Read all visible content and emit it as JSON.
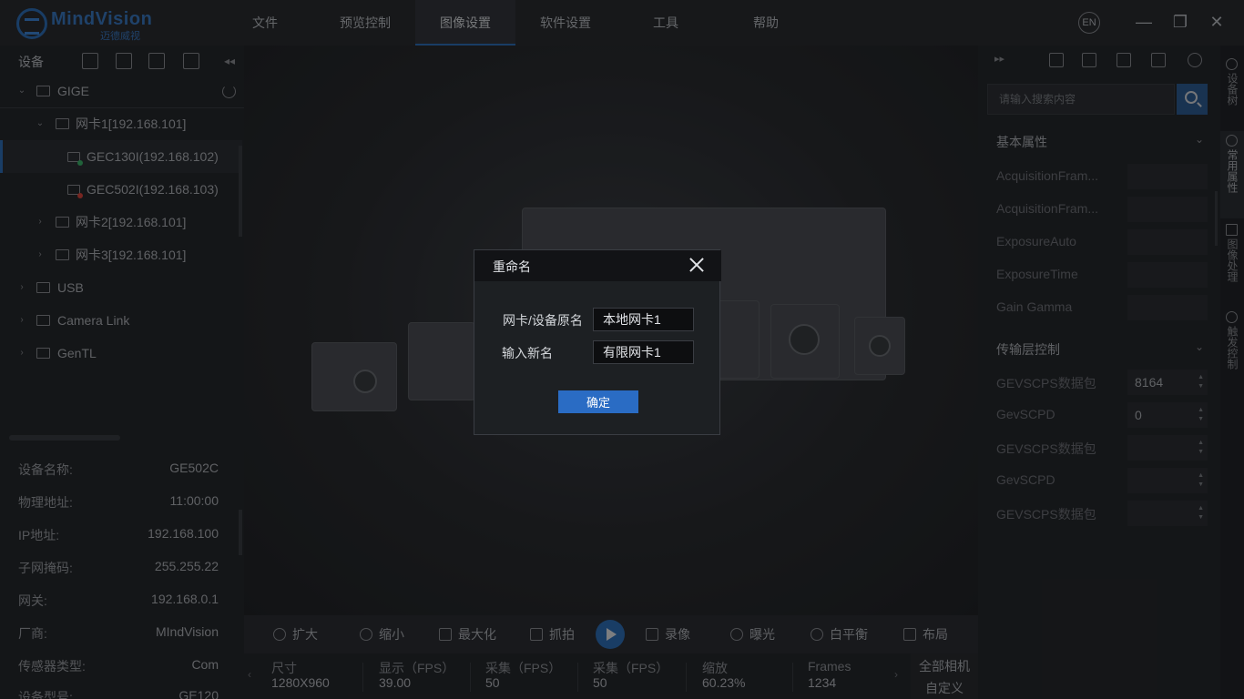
{
  "app": {
    "logo_text": "MindVision",
    "logo_sub": "迈德威视",
    "menu": [
      "文件",
      "预览控制",
      "图像设置",
      "软件设置",
      "工具",
      "帮助"
    ],
    "lang_badge": "EN",
    "accent_color": "#2f6fb8"
  },
  "left": {
    "title": "设备",
    "tree": [
      {
        "label": "GIGE",
        "icon": "folder-icon"
      },
      {
        "label": "网卡1[192.168.101]",
        "icon": "folder-icon"
      },
      {
        "label": "GEC130I(192.168.102)",
        "icon": "camera-icon",
        "status": "green"
      },
      {
        "label": "GEC502I(192.168.103)",
        "icon": "camera-icon",
        "status": "red"
      },
      {
        "label": "网卡2[192.168.101]",
        "icon": "folder-icon"
      },
      {
        "label": "网卡3[192.168.101]",
        "icon": "folder-icon"
      },
      {
        "label": "USB",
        "icon": "folder-icon"
      },
      {
        "label": "Camera Link",
        "icon": "folder-icon"
      },
      {
        "label": "GenTL",
        "icon": "folder-icon"
      }
    ],
    "info": [
      {
        "k": "设备名称:",
        "v": "GE502C"
      },
      {
        "k": "物理地址:",
        "v": "11:00:00"
      },
      {
        "k": "IP地址:",
        "v": "192.168.100"
      },
      {
        "k": "子网掩码:",
        "v": "255.255.22"
      },
      {
        "k": "网关:",
        "v": "192.168.0.1"
      },
      {
        "k": "厂商:",
        "v": "MIndVision"
      },
      {
        "k": "传感器类型:",
        "v": "Com"
      },
      {
        "k": "设备型号:",
        "v": "GE120"
      }
    ]
  },
  "toolbar": {
    "items": [
      "扩大",
      "缩小",
      "最大化",
      "抓拍",
      "录像",
      "曝光",
      "白平衡",
      "布局"
    ]
  },
  "status": {
    "cols": [
      {
        "h": "尺寸",
        "n": "1280X960"
      },
      {
        "h": "显示（FPS）",
        "n": "39.00"
      },
      {
        "h": "采集（FPS）",
        "n": "50"
      },
      {
        "h": "采集（FPS）",
        "n": "50"
      },
      {
        "h": "缩放",
        "n": "60.23%"
      },
      {
        "h": "Frames",
        "n": "1234"
      }
    ],
    "right": [
      "全部相机",
      "自定义"
    ]
  },
  "right": {
    "search_placeholder": "请输入搜索内容",
    "section1": "基本属性",
    "props1": [
      {
        "k": "AcquisitionFram...",
        "v": ""
      },
      {
        "k": "AcquisitionFram...",
        "v": ""
      },
      {
        "k": "ExposureAuto",
        "v": ""
      },
      {
        "k": "ExposureTime",
        "v": ""
      },
      {
        "k": "Gain Gamma",
        "v": ""
      }
    ],
    "section2": "传输层控制",
    "props2": [
      {
        "k": "GEVSCPS数据包",
        "v": "8164"
      },
      {
        "k": "GevSCPD",
        "v": "0"
      },
      {
        "k": "GEVSCPS数据包",
        "v": ""
      },
      {
        "k": "GevSCPD",
        "v": ""
      },
      {
        "k": "GEVSCPS数据包",
        "v": ""
      }
    ]
  },
  "rail": [
    "设备树",
    "常用属性",
    "图像处理",
    "触发控制"
  ],
  "dialog": {
    "title": "重命名",
    "original_label": "网卡/设备原名",
    "original_value": "本地网卡1",
    "new_label": "输入新名",
    "new_value": "有限网卡1",
    "ok_label": "确定"
  }
}
